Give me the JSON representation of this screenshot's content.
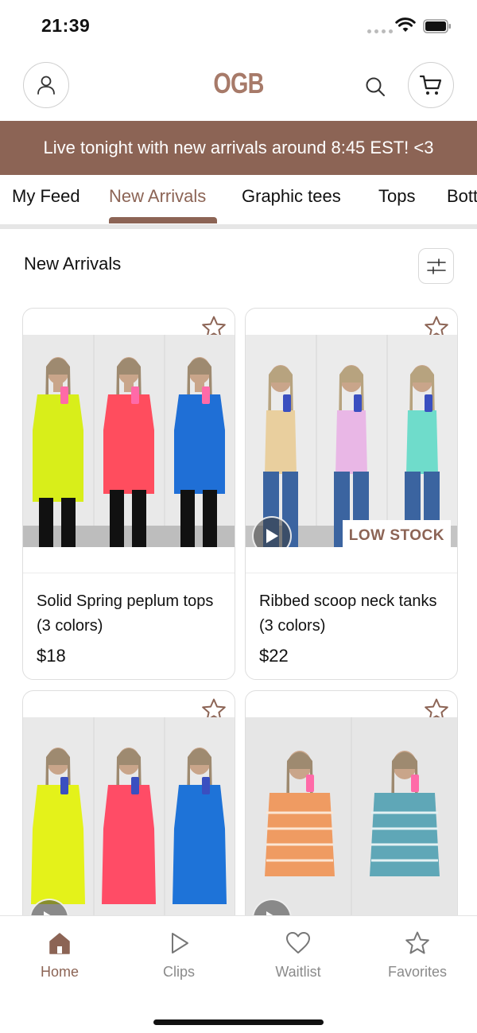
{
  "status": {
    "time": "21:39"
  },
  "header": {
    "logo": "OGB"
  },
  "banner": {
    "text": "Live tonight with new arrivals around 8:45 EST! <3"
  },
  "tabs": [
    {
      "label": "My Feed"
    },
    {
      "label": "New Arrivals",
      "active": true
    },
    {
      "label": "Graphic tees"
    },
    {
      "label": "Tops"
    },
    {
      "label": "Bottoms"
    }
  ],
  "section": {
    "title": "New Arrivals"
  },
  "products": [
    {
      "title": "Solid Spring peplum tops (3 colors)",
      "price": "$18",
      "colors": [
        "#d8ee1a",
        "#ff4d5e",
        "#1f6fd6"
      ],
      "has_video": false,
      "badge": ""
    },
    {
      "title": "Ribbed scoop neck tanks (3 colors)",
      "price": "$22",
      "colors": [
        "#e9cf9e",
        "#e9b7e6",
        "#6fdccb"
      ],
      "has_video": true,
      "badge": "LOW STOCK"
    },
    {
      "title": "",
      "price": "",
      "colors": [
        "#e4f21a",
        "#ff4c66",
        "#1e73d8"
      ],
      "has_video": true,
      "badge": ""
    },
    {
      "title": "",
      "price": "",
      "colors": [
        "#ef9b62",
        "#5fa7b7"
      ],
      "has_video": true,
      "badge": ""
    }
  ],
  "nav": [
    {
      "label": "Home",
      "active": true
    },
    {
      "label": "Clips"
    },
    {
      "label": "Waitlist"
    },
    {
      "label": "Favorites"
    }
  ],
  "colors": {
    "brand": "#8c6455",
    "logo": "#a77a69",
    "inactive": "#8a8a8a"
  }
}
